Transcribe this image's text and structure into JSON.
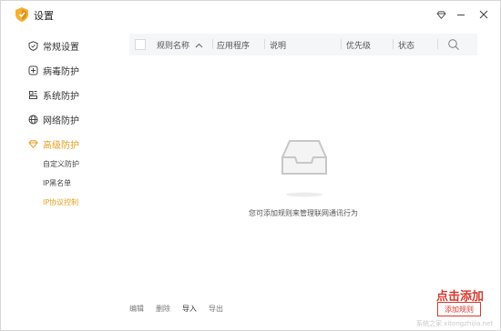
{
  "window": {
    "title": "设置"
  },
  "titlebar": {
    "skin_icon": "diamond-icon",
    "min_icon": "minimize-icon",
    "close_icon": "close-icon"
  },
  "sidebar": {
    "items": [
      {
        "label": "常规设置",
        "icon": "shield-icon",
        "active": false
      },
      {
        "label": "病毒防护",
        "icon": "plus-box-icon",
        "active": false
      },
      {
        "label": "系统防护",
        "icon": "system-icon",
        "active": false
      },
      {
        "label": "网络防护",
        "icon": "globe-icon",
        "active": false
      },
      {
        "label": "高级防护",
        "icon": "diamond-icon",
        "active": true
      }
    ],
    "subitems": [
      {
        "label": "自定义防护",
        "active": false
      },
      {
        "label": "IP黑名单",
        "active": false
      },
      {
        "label": "IP协议控制",
        "active": true
      }
    ]
  },
  "table": {
    "headers": {
      "name": "规则名称",
      "app": "应用程序",
      "desc": "说明",
      "priority": "优先级",
      "status": "状态"
    }
  },
  "empty_state": {
    "text": "您可添加规则来管理联网通讯行为",
    "icon": "empty-tray-icon"
  },
  "footer": {
    "edit": "编辑",
    "delete": "删除",
    "import": "导入",
    "export": "导出"
  },
  "add_button": {
    "label": "添加规则"
  },
  "annotation": {
    "hint": "点击添加"
  },
  "watermark": "系统之家 xitongzhijia.net",
  "colors": {
    "accent": "#e59e1f",
    "annotation": "#d63a2e",
    "header_bg": "#f5f6f7"
  }
}
